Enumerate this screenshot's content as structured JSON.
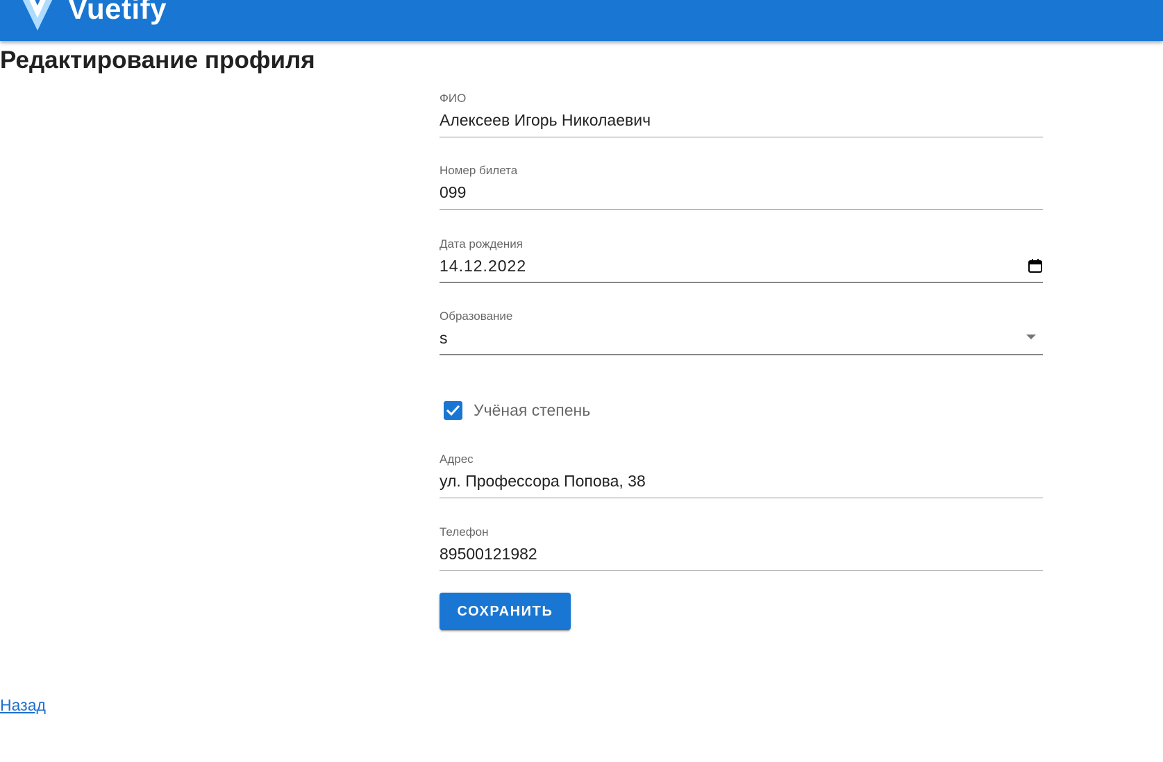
{
  "app_bar": {
    "brand": "Vuetify",
    "logo_icon": "vuetify-logo-icon",
    "color": "#1976d2"
  },
  "page": {
    "title": "Редактирование профиля"
  },
  "form": {
    "full_name": {
      "label": "ФИО",
      "value": "Алексеев Игорь Николаевич"
    },
    "ticket_number": {
      "label": "Номер билета",
      "value": "099"
    },
    "birth_date": {
      "label": "Дата рождения",
      "value": "14.12.2022",
      "icon": "calendar-icon"
    },
    "education": {
      "label": "Образование",
      "value": "s",
      "icon": "chevron-down-icon"
    },
    "academic_degree": {
      "label": "Учёная степень",
      "checked": true
    },
    "address": {
      "label": "Адрес",
      "value": "ул. Профессора Попова, 38"
    },
    "phone": {
      "label": "Телефон",
      "value": "89500121982"
    },
    "save_label": "СОХРАНИТЬ"
  },
  "back_link": "Назад",
  "colors": {
    "primary": "#1976d2",
    "link": "#1f6fcf"
  }
}
